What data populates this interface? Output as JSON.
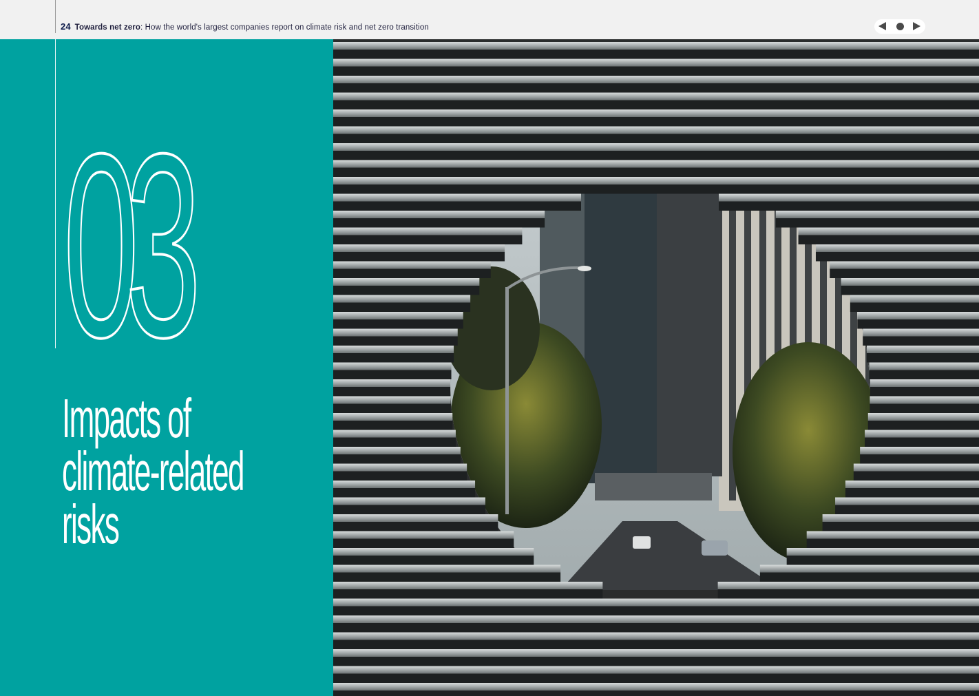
{
  "header": {
    "page_number": "24",
    "doc_title": "Towards net zero",
    "doc_subtitle": ": How the world's largest companies report on climate risk and net zero transition"
  },
  "nav": {
    "prev_icon": "triangle-left-icon",
    "home_icon": "dot-icon",
    "next_icon": "triangle-right-icon",
    "color": "#4a4a4a"
  },
  "chapter": {
    "number": "03",
    "title_lines": [
      "Impacts of",
      "climate-related",
      "risks"
    ],
    "panel_color": "#00a2a0"
  }
}
